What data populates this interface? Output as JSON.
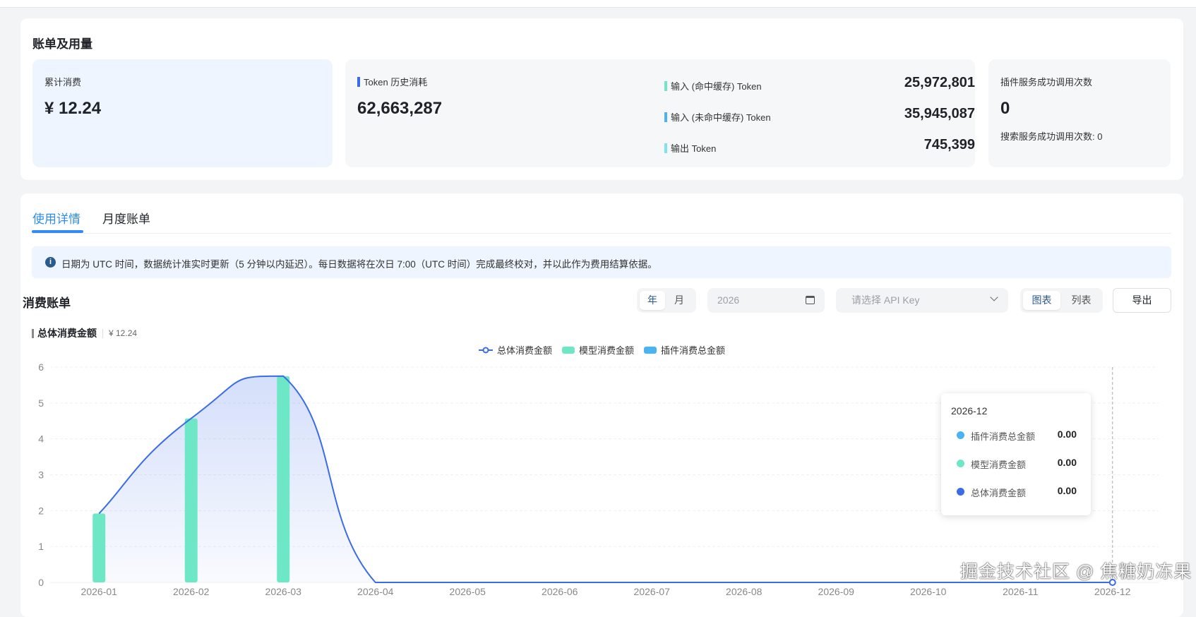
{
  "usage": {
    "title": "账单及用量",
    "cumulative": {
      "label": "累计消费",
      "value": "¥ 12.24"
    },
    "token": {
      "label": "Token 历史消耗",
      "value": "62,663,287",
      "rows": [
        {
          "name": "输入 (命中缓存) Token",
          "value": "25,972,801",
          "color": "#6ee7c7"
        },
        {
          "name": "输入 (未命中缓存) Token",
          "value": "35,945,087",
          "color": "#4ab3f4"
        },
        {
          "name": "输出 Token",
          "value": "745,399",
          "color": "#7de3f0"
        }
      ]
    },
    "plugin": {
      "label": "插件服务成功调用次数",
      "value": "0",
      "search": "搜索服务成功调用次数: 0"
    }
  },
  "tabs": [
    {
      "label": "使用详情",
      "active": true
    },
    {
      "label": "月度账单",
      "active": false
    }
  ],
  "notice": "日期为 UTC 时间，数据统计准实时更新（5 分钟以内延迟）。每日数据将在次日 7:00（UTC 时间）完成最终校对，并以此作为费用结算依据。",
  "bill": {
    "title": "消费账单",
    "period": [
      "年",
      "月"
    ],
    "period_selected": "年",
    "year": "2026",
    "api_key_placeholder": "请选择 API Key",
    "view": [
      "图表",
      "列表"
    ],
    "view_selected": "图表",
    "export": "导出",
    "summary_label": "总体消费金额",
    "summary_value": "¥ 12.24"
  },
  "chart_data": {
    "type": "bar+line",
    "categories": [
      "2026-01",
      "2026-02",
      "2026-03",
      "2026-04",
      "2026-05",
      "2026-06",
      "2026-07",
      "2026-08",
      "2026-09",
      "2026-10",
      "2026-11",
      "2026-12"
    ],
    "series": [
      {
        "name": "总体消费金额",
        "type": "line",
        "color": "#3b6ce8",
        "values": [
          1.92,
          4.57,
          5.75,
          0,
          0,
          0,
          0,
          0,
          0,
          0,
          0,
          0
        ]
      },
      {
        "name": "模型消费金额",
        "type": "bar",
        "color": "#6ee7c7",
        "values": [
          1.92,
          4.57,
          5.75,
          0,
          0,
          0,
          0,
          0,
          0,
          0,
          0,
          0
        ]
      },
      {
        "name": "插件消费总金额",
        "type": "bar",
        "color": "#4ab3f4",
        "values": [
          0,
          0,
          0,
          0,
          0,
          0,
          0,
          0,
          0,
          0,
          0,
          0
        ]
      }
    ],
    "yticks": [
      "0",
      "1",
      "2",
      "3",
      "4",
      "5",
      "6"
    ],
    "ylim": [
      0,
      6
    ],
    "grid": true,
    "legend": "top-center"
  },
  "tooltip": {
    "title": "2026-12",
    "rows": [
      {
        "name": "插件消费总金额",
        "value": "0.00",
        "color": "#4ab3f4"
      },
      {
        "name": "模型消费金额",
        "value": "0.00",
        "color": "#6ee7c7"
      },
      {
        "name": "总体消费金额",
        "value": "0.00",
        "color": "#3b6ce8"
      }
    ]
  },
  "watermark": "掘金技术社区 @ 焦糖奶冻果"
}
